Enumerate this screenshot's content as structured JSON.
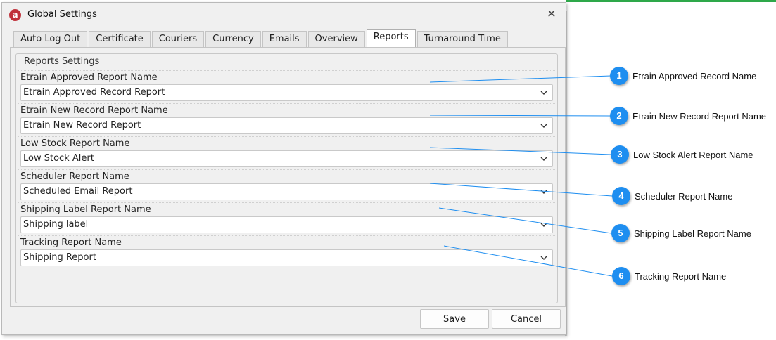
{
  "window": {
    "title": "Global Settings",
    "app_icon": "a"
  },
  "tabs": [
    {
      "label": "Auto Log Out"
    },
    {
      "label": "Certificate"
    },
    {
      "label": "Couriers"
    },
    {
      "label": "Currency"
    },
    {
      "label": "Emails"
    },
    {
      "label": "Overview"
    },
    {
      "label": "Reports",
      "active": true
    },
    {
      "label": "Turnaround Time"
    }
  ],
  "group_title": "Reports Settings",
  "fields": [
    {
      "label": "Etrain Approved Report Name",
      "value": "Etrain Approved Record Report"
    },
    {
      "label": "Etrain New Record Report Name",
      "value": "Etrain New Record Report"
    },
    {
      "label": "Low Stock Report Name",
      "value": "Low Stock Alert"
    },
    {
      "label": "Scheduler Report Name",
      "value": "Scheduled Email Report"
    },
    {
      "label": "Shipping Label Report Name",
      "value": "Shipping label"
    },
    {
      "label": "Tracking Report Name",
      "value": "Shipping Report"
    }
  ],
  "buttons": {
    "save": "Save",
    "cancel": "Cancel"
  },
  "callouts": [
    {
      "number": "1",
      "text": "Etrain Approved Record Name"
    },
    {
      "number": "2",
      "text": "Etrain New Record Report Name"
    },
    {
      "number": "3",
      "text": "Low Stock Alert Report Name"
    },
    {
      "number": "4",
      "text": "Scheduler Report Name"
    },
    {
      "number": "5",
      "text": "Shipping Label Report Name"
    },
    {
      "number": "6",
      "text": "Tracking Report Name"
    }
  ],
  "colors": {
    "callout_badge": "#1e8ef0",
    "app_icon": "#c0313a",
    "callout_line": "#1e8ef0"
  }
}
